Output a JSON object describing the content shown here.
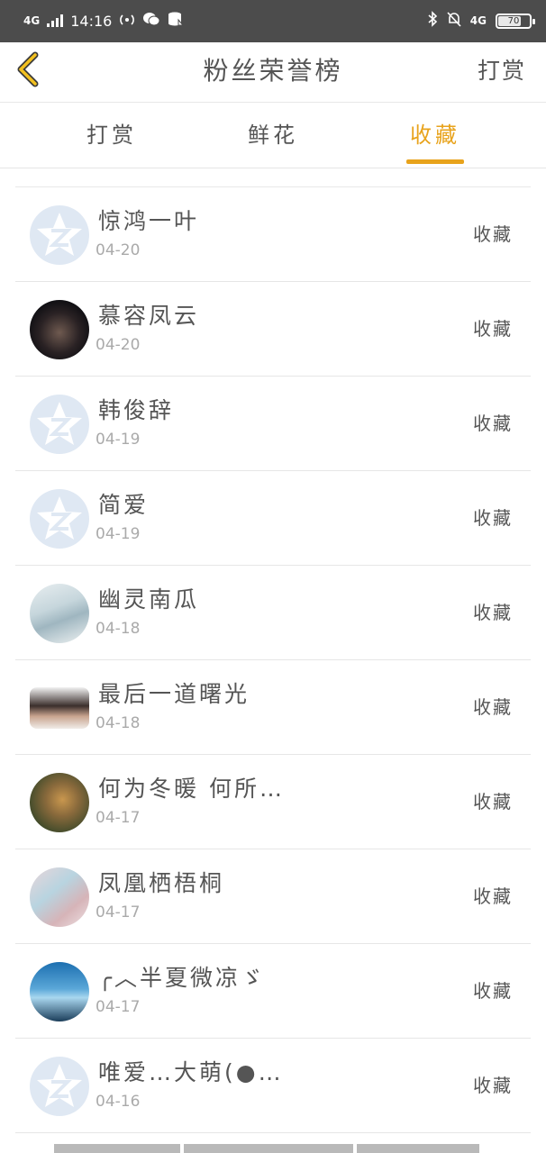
{
  "status_bar": {
    "network_left": "4G",
    "time": "14:16",
    "network_right": "4G",
    "battery": "70"
  },
  "nav": {
    "back_icon": "chevron-left-icon",
    "title": "粉丝荣誉榜",
    "action": "打赏"
  },
  "tabs": [
    {
      "label": "打赏",
      "active": false
    },
    {
      "label": "鲜花",
      "active": false
    },
    {
      "label": "收藏",
      "active": true
    }
  ],
  "accent_color": "#e8a31c",
  "rows": [
    {
      "name": "惊鸿一叶",
      "date": "04-20",
      "action": "收藏",
      "avatar": "default-avatar-icon"
    },
    {
      "name": "慕容凤云",
      "date": "04-20",
      "action": "收藏",
      "avatar": "user-photo"
    },
    {
      "name": "韩俊辞",
      "date": "04-19",
      "action": "收藏",
      "avatar": "default-avatar-icon"
    },
    {
      "name": "简爱",
      "date": "04-19",
      "action": "收藏",
      "avatar": "default-avatar-icon"
    },
    {
      "name": "幽灵南瓜",
      "date": "04-18",
      "action": "收藏",
      "avatar": "user-photo"
    },
    {
      "name": "最后一道曙光",
      "date": "04-18",
      "action": "收藏",
      "avatar": "user-photo"
    },
    {
      "name": "何为冬暖 何所…",
      "date": "04-17",
      "action": "收藏",
      "avatar": "user-photo"
    },
    {
      "name": "凤凰栖梧桐",
      "date": "04-17",
      "action": "收藏",
      "avatar": "user-photo"
    },
    {
      "name": "╭︿半夏微凉ゞ",
      "date": "04-17",
      "action": "收藏",
      "avatar": "user-photo"
    },
    {
      "name": "唯爱…大萌(●…",
      "date": "04-16",
      "action": "收藏",
      "avatar": "default-avatar-icon"
    }
  ]
}
